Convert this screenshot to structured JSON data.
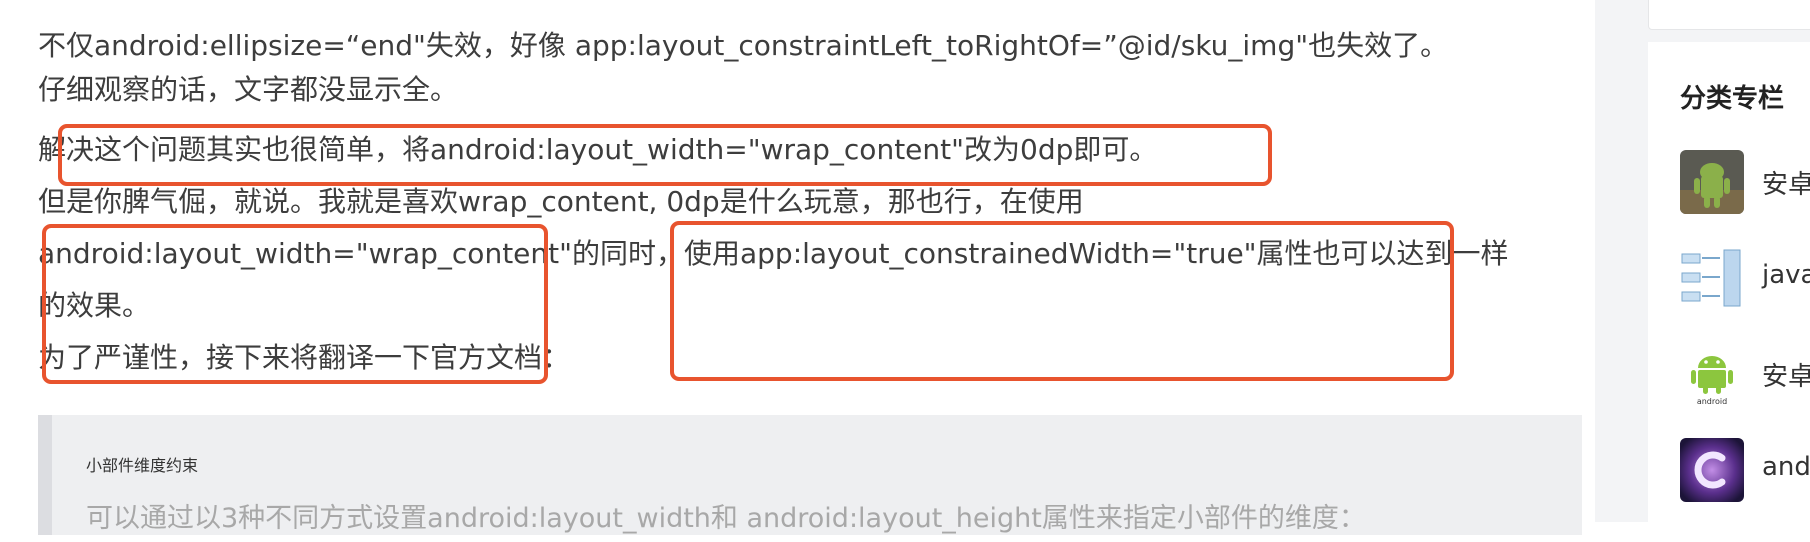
{
  "article": {
    "lines": [
      "不仅android:ellipsize=“end\"失效，好像 app:layout_constraintLeft_toRightOf=”@id/sku_img\"也失效了。",
      "仔细观察的话，文字都没显示全。",
      "解决这个问题其实也很简单，将android:layout_width=\"wrap_content\"改为0dp即可。",
      "但是你脾气倔，就说。我就是喜欢wrap_content, 0dp是什么玩意，那也行，在使用",
      "android:layout_width=\"wrap_content\"的同时，使用app:layout_constrainedWidth=\"true\"属性也可以达到一样",
      "的效果。",
      "为了严谨性，接下来将翻译一下官方文档："
    ],
    "quote": {
      "title": "小部件维度约束",
      "line": "可以通过以3种不同方式设置android:layout_width和 android:layout_height属性来指定小部件的维度："
    },
    "highlight_color": "#e8542e"
  },
  "sidebar": {
    "title": "分类专栏",
    "items": [
      {
        "label": "安卓",
        "icon": "android-robot-photo-icon"
      },
      {
        "label": "java",
        "icon": "diagram-thumbnail-icon"
      },
      {
        "label": "安卓",
        "icon": "android-logo-icon"
      },
      {
        "label": "andr",
        "icon": "galaxy-c-icon"
      }
    ]
  }
}
